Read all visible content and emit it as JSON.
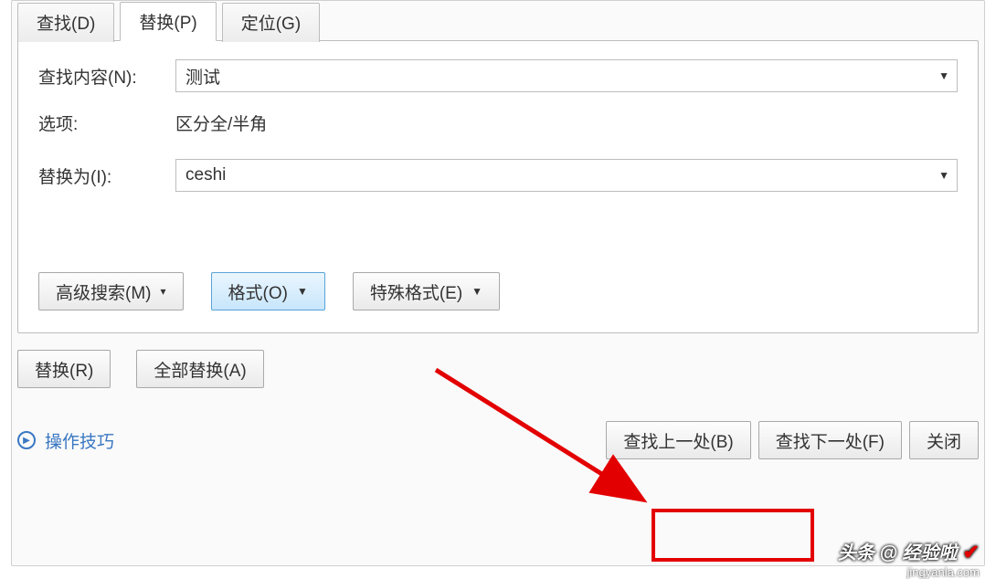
{
  "tabs": {
    "find": "查找(D)",
    "replace": "替换(P)",
    "goto": "定位(G)"
  },
  "labels": {
    "find_what": "查找内容(N):",
    "options": "选项:",
    "replace_with": "替换为(I):"
  },
  "values": {
    "find_what": "测试",
    "options_text": "区分全/半角",
    "replace_with": "ceshi"
  },
  "buttons": {
    "advanced_search": "高级搜索(M)",
    "format": "格式(O)",
    "special_format": "特殊格式(E)",
    "replace": "替换(R)",
    "replace_all": "全部替换(A)",
    "find_prev": "查找上一处(B)",
    "find_next": "查找下一处(F)",
    "close": "关闭"
  },
  "tips": "操作技巧",
  "watermark": {
    "main": "头条 @ 经验啦",
    "sub": "jingyanla.com"
  }
}
